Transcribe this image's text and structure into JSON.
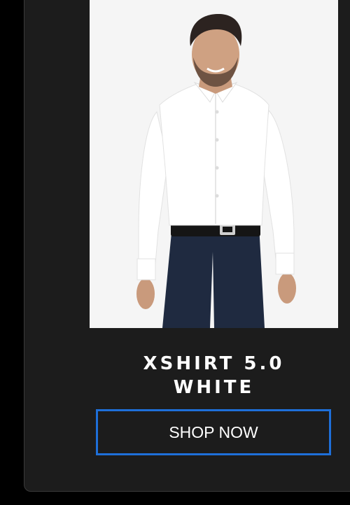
{
  "product": {
    "title_line1": "XSHIRT 5.0",
    "title_line2": "WHITE",
    "image": "model-wearing-white-dress-shirt"
  },
  "cta": {
    "label": "SHOP NOW"
  },
  "colors": {
    "page_background": "#000000",
    "card_background": "#1c1c1c",
    "image_background": "#f5f5f5",
    "button_border": "#1e6fd9",
    "text": "#ffffff"
  }
}
